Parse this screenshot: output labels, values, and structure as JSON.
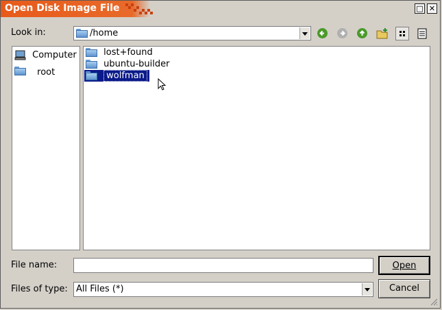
{
  "window": {
    "title": "Open Disk Image File",
    "maximize_glyph": "□",
    "close_glyph": "✕"
  },
  "lookin": {
    "label": "Look in:",
    "path": "/home"
  },
  "toolbar": {
    "back_icon": "back-arrow-icon",
    "forward_icon": "forward-arrow-icon",
    "up_icon": "parent-directory-icon",
    "newfolder_icon": "new-folder-icon",
    "listview_icon": "list-view-icon",
    "detailview_icon": "detail-view-icon",
    "colors": {
      "back": "#4a9a2a",
      "forward": "#a0a0a0",
      "up": "#4a9a2a"
    }
  },
  "sidebar": {
    "items": [
      {
        "label": "Computer",
        "icon": "computer-icon"
      },
      {
        "label": "root",
        "icon": "folder-icon"
      }
    ]
  },
  "files": {
    "items": [
      {
        "label": "lost+found",
        "selected": false
      },
      {
        "label": "ubuntu-builder",
        "selected": false
      },
      {
        "label": "wolfman",
        "selected": true
      }
    ]
  },
  "filename": {
    "label": "File name:",
    "value": ""
  },
  "filetype": {
    "label": "Files of type:",
    "value": "All Files (*)"
  },
  "buttons": {
    "open": "Open",
    "cancel": "Cancel"
  }
}
